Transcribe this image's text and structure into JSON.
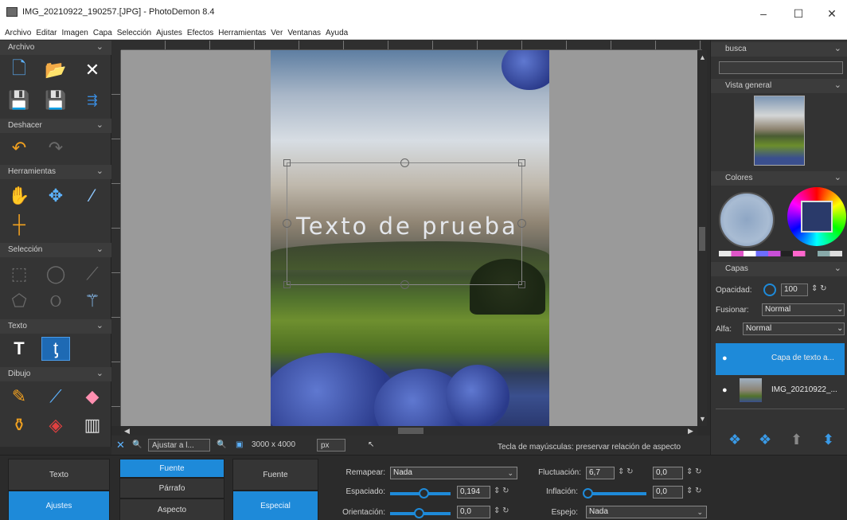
{
  "window": {
    "title": "IMG_20210922_190257.[JPG] - PhotoDemon 8.4",
    "minimize": "–",
    "maximize": "☐",
    "close": "✕"
  },
  "menu": [
    "Archivo",
    "Editar",
    "Imagen",
    "Capa",
    "Selección",
    "Ajustes",
    "Efectos",
    "Herramientas",
    "Ver",
    "Ventanas",
    "Ayuda"
  ],
  "toolbox": {
    "sections": {
      "archivo": "Archivo",
      "deshacer": "Deshacer",
      "herramientas": "Herramientas",
      "seleccion": "Selección",
      "texto": "Texto",
      "dibujo": "Dibujo"
    },
    "chevron": "⌄"
  },
  "canvas": {
    "overlay_text": "Texto de prueba"
  },
  "statusbar": {
    "zoom": "Ajustar a l...",
    "size": "3000 x 4000",
    "unit": "px",
    "hint": "Tecla de mayúsculas: preservar relación de aspecto"
  },
  "right_panel": {
    "search_header": "busca",
    "overview_header": "Vista general",
    "colors_header": "Colores",
    "layers_header": "Capas",
    "opacity_label": "Opacidad:",
    "opacity_value": "100",
    "blend_label": "Fusionar:",
    "blend_value": "Normal",
    "alpha_label": "Alfa:",
    "alpha_value": "Normal",
    "layers": [
      {
        "name": "Capa de texto a...",
        "active": true
      },
      {
        "name": "IMG_20210922_...",
        "active": false
      }
    ]
  },
  "options": {
    "left_tabs": [
      "Texto",
      "Ajustes"
    ],
    "mid_tabs": [
      "Fuente",
      "Párrafo",
      "Aspecto"
    ],
    "right_tabs": [
      "Fuente",
      "Especial"
    ],
    "remap_label": "Remapear:",
    "remap_value": "Nada",
    "spacing_label": "Espaciado:",
    "spacing_value": "0,194",
    "orientation_label": "Orientación:",
    "orientation_value": "0,0",
    "fluctuation_label": "Fluctuación:",
    "fluctuation_value": "6,7",
    "fluctuation_value2": "0,0",
    "inflation_label": "Inflación:",
    "inflation_value": "0,0",
    "mirror_label": "Espejo:",
    "mirror_value": "Nada"
  },
  "colors": {
    "accent": "#1e8ad9",
    "panel_bg": "#343434"
  }
}
